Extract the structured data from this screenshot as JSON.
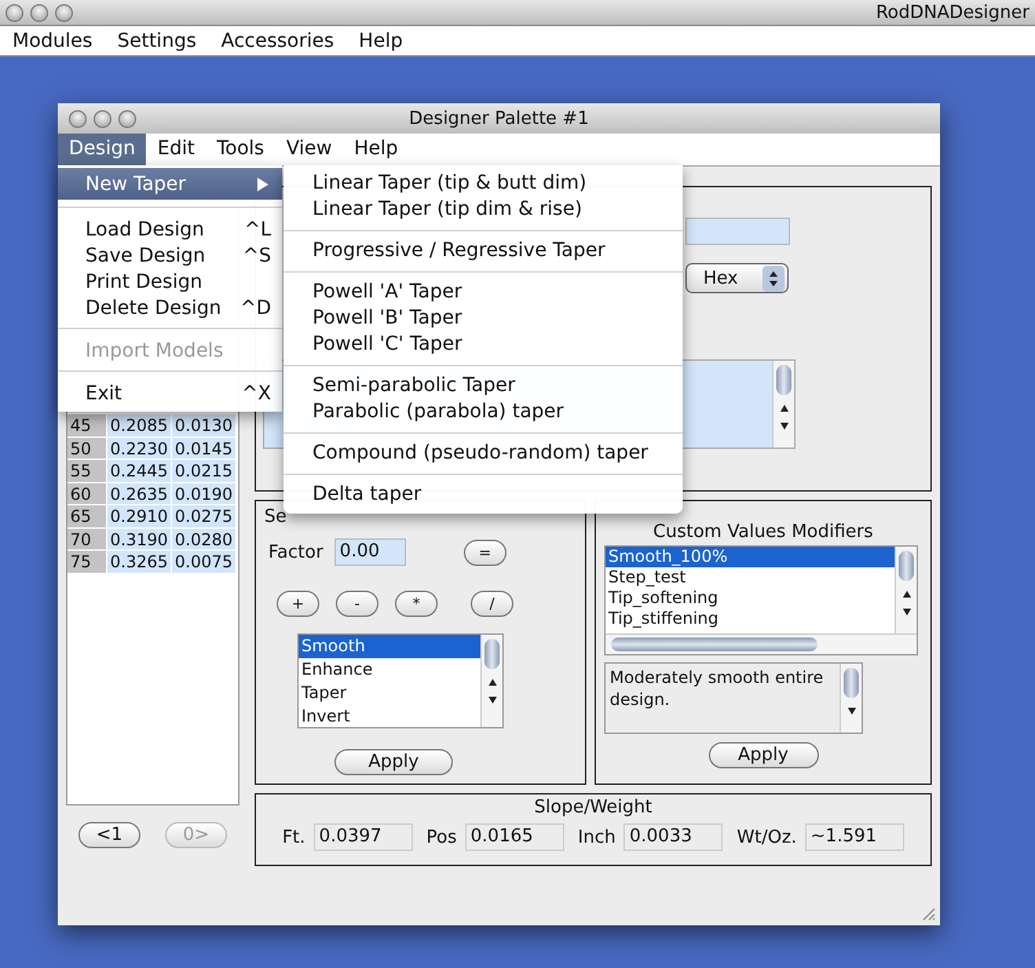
{
  "app": {
    "title": "RodDNADesigner",
    "menus": [
      "Modules",
      "Settings",
      "Accessories",
      "Help"
    ]
  },
  "window": {
    "title": "Designer Palette #1"
  },
  "menu_bar": [
    {
      "label": "Design",
      "selected": true
    },
    {
      "label": "Edit",
      "selected": false
    },
    {
      "label": "Tools",
      "selected": false
    },
    {
      "label": "View",
      "selected": false
    },
    {
      "label": "Help",
      "selected": false
    }
  ],
  "design_menu": [
    {
      "kind": "submenu",
      "label": "New Taper",
      "selected": true,
      "disabled": false
    },
    {
      "kind": "separator"
    },
    {
      "kind": "item",
      "label": "Load Design",
      "shortcut": "^L",
      "selected": false,
      "disabled": false
    },
    {
      "kind": "item",
      "label": "Save Design",
      "shortcut": "^S",
      "selected": false,
      "disabled": false
    },
    {
      "kind": "item",
      "label": "Print Design",
      "selected": false,
      "disabled": false
    },
    {
      "kind": "item",
      "label": "Delete Design",
      "shortcut": "^D",
      "selected": false,
      "disabled": false
    },
    {
      "kind": "separator"
    },
    {
      "kind": "item",
      "label": "Import Models",
      "selected": false,
      "disabled": true
    },
    {
      "kind": "separator"
    },
    {
      "kind": "item",
      "label": "Exit",
      "shortcut": "^X",
      "selected": false,
      "disabled": false
    }
  ],
  "taper_submenu": [
    {
      "kind": "item",
      "label": "Linear Taper (tip & butt dim)"
    },
    {
      "kind": "item",
      "label": "Linear Taper (tip dim & rise)"
    },
    {
      "kind": "separator"
    },
    {
      "kind": "item",
      "label": "Progressive / Regressive Taper"
    },
    {
      "kind": "separator"
    },
    {
      "kind": "item",
      "label": "Powell 'A' Taper"
    },
    {
      "kind": "item",
      "label": "Powell 'B' Taper"
    },
    {
      "kind": "item",
      "label": "Powell 'C' Taper"
    },
    {
      "kind": "separator"
    },
    {
      "kind": "item",
      "label": "Semi-parabolic Taper"
    },
    {
      "kind": "item",
      "label": "Parabolic (parabola) taper"
    },
    {
      "kind": "separator"
    },
    {
      "kind": "item",
      "label": "Compound (pseudo-random) taper"
    },
    {
      "kind": "separator"
    },
    {
      "kind": "item",
      "label": "Delta taper"
    }
  ],
  "table": {
    "rows": [
      [
        "45",
        "0.2085",
        "0.0130"
      ],
      [
        "50",
        "0.2230",
        "0.0145"
      ],
      [
        "55",
        "0.2445",
        "0.0215"
      ],
      [
        "60",
        "0.2635",
        "0.0190"
      ],
      [
        "65",
        "0.2910",
        "0.0275"
      ],
      [
        "70",
        "0.3190",
        "0.0280"
      ],
      [
        "75",
        "0.3265",
        "0.0075"
      ]
    ]
  },
  "nav_buttons": [
    {
      "label": "<1",
      "disabled": false
    },
    {
      "label": "0>",
      "disabled": true
    }
  ],
  "properties": {
    "unit_select": "Hex"
  },
  "calculator": {
    "title": "Se",
    "factor_label": "Factor",
    "factor_value": "0.00",
    "equals": "=",
    "operators": [
      "+",
      "-",
      "*",
      "/"
    ],
    "list": [
      {
        "label": "Smooth",
        "selected": true
      },
      {
        "label": "Enhance",
        "selected": false
      },
      {
        "label": "Taper",
        "selected": false
      },
      {
        "label": "Invert",
        "selected": false
      }
    ],
    "apply": "Apply"
  },
  "modifiers": {
    "title": "Custom Values Modifiers",
    "list": [
      {
        "label": "Smooth_100%",
        "selected": true
      },
      {
        "label": "Step_test",
        "selected": false
      },
      {
        "label": "Tip_softening",
        "selected": false
      },
      {
        "label": "Tip_stiffening",
        "selected": false
      }
    ],
    "description": "Moderately smooth entire design.",
    "apply": "Apply"
  },
  "slope_weight": {
    "title": "Slope/Weight",
    "fields": [
      {
        "label": "Ft.",
        "value": "0.0397"
      },
      {
        "label": "Pos",
        "value": "0.0165"
      },
      {
        "label": "Inch",
        "value": "0.0033"
      },
      {
        "label": "Wt/Oz.",
        "value": "~1.591"
      }
    ]
  }
}
